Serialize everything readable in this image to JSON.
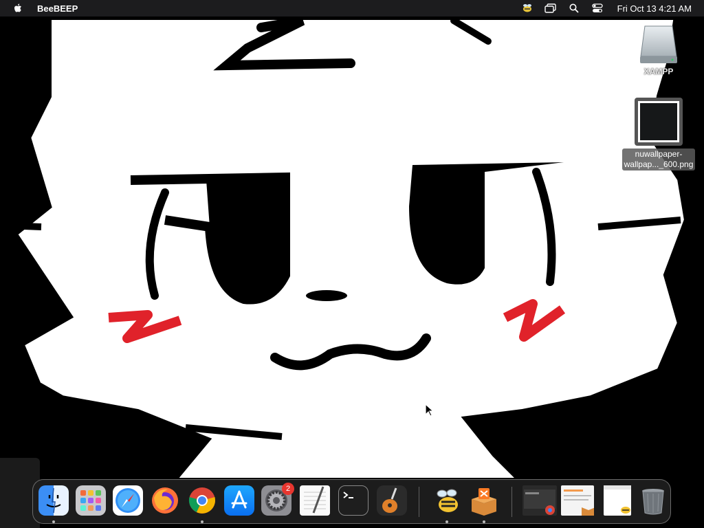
{
  "menubar": {
    "app_name": "BeeBEEP",
    "clock": "Fri Oct 13  4:21 AM",
    "icons": [
      "apple-icon",
      "beebeep-status-icon",
      "window-switch-icon",
      "spotlight-search-icon",
      "control-center-icon"
    ]
  },
  "desktop": {
    "items": [
      {
        "name": "XAMPP",
        "icon": "drive-icon"
      },
      {
        "name": "nuwallpaper-\nwallpap..._600.png",
        "line1": "nuwallpaper-",
        "line2": "wallpap..._600.png",
        "icon": "image-file-icon"
      }
    ]
  },
  "dock": {
    "items": [
      {
        "name": "Finder",
        "icon": "finder-icon",
        "running": true
      },
      {
        "name": "Launchpad",
        "icon": "launchpad-icon",
        "running": false
      },
      {
        "name": "Safari",
        "icon": "safari-icon",
        "running": false
      },
      {
        "name": "Firefox",
        "icon": "firefox-icon",
        "running": false
      },
      {
        "name": "Google Chrome",
        "icon": "chrome-icon",
        "running": true
      },
      {
        "name": "App Store",
        "icon": "app-store-icon",
        "running": false
      },
      {
        "name": "System Settings",
        "icon": "system-settings-icon",
        "running": false,
        "badge": "2"
      },
      {
        "name": "TextEdit",
        "icon": "textedit-icon",
        "running": false
      },
      {
        "name": "Terminal",
        "icon": "terminal-icon",
        "running": false
      },
      {
        "name": "GarageBand",
        "icon": "garageband-icon",
        "running": false
      },
      {
        "name": "BeeBEEP",
        "icon": "beebeep-icon",
        "running": true
      },
      {
        "name": "XAMPP",
        "icon": "xampp-icon",
        "running": true
      },
      {
        "name": "Chrome window",
        "icon": "chrome-window-thumbnail",
        "running": false
      },
      {
        "name": "XAMPP window",
        "icon": "xampp-window-thumbnail",
        "running": false
      },
      {
        "name": "BeeBEEP window",
        "icon": "beebeep-window-thumbnail",
        "running": false
      },
      {
        "name": "Trash",
        "icon": "trash-icon",
        "running": false
      }
    ]
  },
  "colors": {
    "menubar_bg": "#1c1c1e",
    "blush": "#e0222a",
    "badge": "#e8362f"
  }
}
